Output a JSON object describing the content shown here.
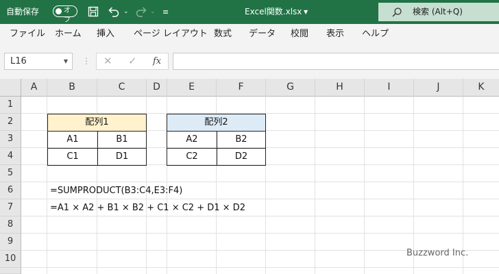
{
  "titlebar": {
    "autosave_label": "自動保存",
    "autosave_state": "オフ",
    "filename": "Excel関数.xlsx",
    "search_label": "検索 (Alt+Q)",
    "bg_color": "#217346"
  },
  "ribbon": {
    "tabs": [
      "ファイル",
      "ホーム",
      "挿入",
      "ページ レイアウト",
      "数式",
      "データ",
      "校閲",
      "表示",
      "ヘルプ"
    ]
  },
  "formula_bar": {
    "name_box": "L16",
    "fx_label": "fx",
    "value": ""
  },
  "columns": [
    "A",
    "B",
    "C",
    "D",
    "E",
    "F",
    "G",
    "H",
    "I",
    "J",
    "K"
  ],
  "rows": [
    "1",
    "2",
    "3",
    "4",
    "5",
    "6",
    "7",
    "8",
    "9",
    "10"
  ],
  "array1": {
    "header": "配列1",
    "header_color": "#fff2cc",
    "cells": [
      [
        "A1",
        "B1"
      ],
      [
        "C1",
        "D1"
      ]
    ]
  },
  "array2": {
    "header": "配列2",
    "header_color": "#ddebf7",
    "cells": [
      [
        "A2",
        "B2"
      ],
      [
        "C2",
        "D2"
      ]
    ]
  },
  "formulas": {
    "row6": "=SUMPRODUCT(B3:C4,E3:F4)",
    "row7": "=A1 × A2 + B1 × B2 + C1 × C2 + D1 × D2"
  },
  "watermark": "Buzzword Inc."
}
